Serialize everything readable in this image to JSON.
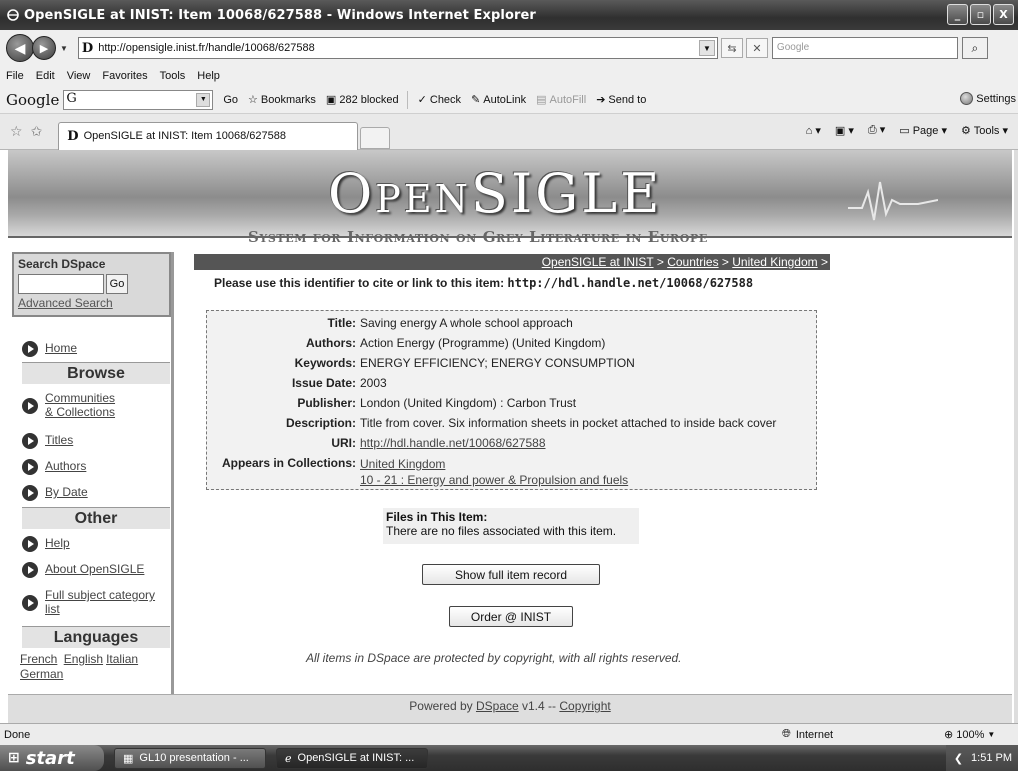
{
  "window": {
    "title": "OpenSIGLE at INIST: Item 10068/627588 - Windows Internet Explorer",
    "buttons": [
      "_",
      "▫",
      "X"
    ]
  },
  "address_bar": {
    "url": "http://opensigle.inist.fr/handle/10068/627588",
    "search_placeholder": "Google"
  },
  "menu": [
    "File",
    "Edit",
    "View",
    "Favorites",
    "Tools",
    "Help"
  ],
  "google_toolbar": {
    "logo": "Google",
    "search_value": "G",
    "go_label": "Go",
    "bookmarks_label": "Bookmarks",
    "blocked_label": "282 blocked",
    "check_label": "Check",
    "autolink_label": "AutoLink",
    "autofill_label": "AutoFill",
    "sendto_label": "Send to",
    "settings_label": "Settings"
  },
  "tabs": {
    "active_title": "OpenSIGLE at INIST: Item 10068/627588",
    "page_label": "Page",
    "tools_label": "Tools"
  },
  "banner": {
    "logo": "OpenSIGLE",
    "subtitle": "System for Information on Grey Literature in Europe"
  },
  "sidebar": {
    "search_title": "Search DSpace",
    "go_label": "Go",
    "advanced_search": "Advanced Search",
    "home": "Home",
    "browse_heading": "Browse",
    "communities_line1": "Communities",
    "communities_line2": "& Collections",
    "titles": "Titles",
    "authors": "Authors",
    "by_date": "By Date",
    "other_heading": "Other",
    "help": "Help",
    "about": "About OpenSIGLE",
    "full_subject_line1": "Full subject category",
    "full_subject_line2": "list",
    "languages_heading": "Languages",
    "lang_french": "French",
    "lang_english": "English",
    "lang_italian": "Italian",
    "lang_german": "German"
  },
  "breadcrumb": {
    "item1": "OpenSIGLE at INIST",
    "sep": " > ",
    "item2": "Countries",
    "item3": "United Kingdom",
    "trail_end": " >"
  },
  "cite": {
    "text": "Please use this identifier to cite or link to this item: ",
    "handle": "http://hdl.handle.net/10068/627588"
  },
  "metadata": {
    "title_key": "Title:",
    "title_val": "Saving energy A whole school approach",
    "authors_key": "Authors:",
    "authors_val": "Action Energy (Programme) (United Kingdom)",
    "keywords_key": "Keywords:",
    "keywords_val": "ENERGY EFFICIENCY; ENERGY CONSUMPTION",
    "date_key": "Issue Date:",
    "date_val": "2003",
    "publisher_key": "Publisher:",
    "publisher_val": "London (United Kingdom) : Carbon Trust",
    "description_key": "Description:",
    "description_val": "Title from cover. Six information sheets in pocket attached to inside back cover",
    "uri_key": "URI:",
    "uri_val": "http://hdl.handle.net/10068/627588",
    "collections_key": "Appears in Collections:",
    "collection_1": "United Kingdom",
    "collection_2": "10 - 21 : Energy and power & Propulsion and fuels"
  },
  "files": {
    "heading": "Files in This Item:",
    "message": "There are no files associated with this item."
  },
  "buttons": {
    "show_full": "Show full item record",
    "order": "Order @ INIST"
  },
  "copyright_note": "All items in DSpace are protected by copyright, with all rights reserved.",
  "footer": {
    "powered_by": "Powered by ",
    "dspace": "DSpace",
    "version": " v1.4 -- ",
    "copyright": "Copyright"
  },
  "status": {
    "text": "Done",
    "zone": "Internet",
    "zoom": "100%"
  },
  "taskbar": {
    "start": "start",
    "item1": "GL10 presentation - ...",
    "item2": "OpenSIGLE at INIST: ...",
    "clock": "1:51 PM"
  }
}
